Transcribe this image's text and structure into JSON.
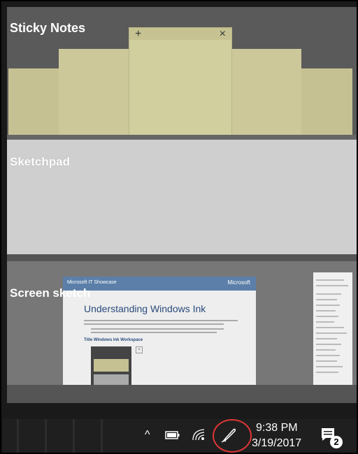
{
  "sticky_notes": {
    "title": "Sticky Notes",
    "note_add_glyph": "+",
    "note_close_glyph": "×"
  },
  "sketchpad": {
    "title": "Sketchpad"
  },
  "screen_sketch": {
    "title": "Screen sketch",
    "doc_header_left": "Microsoft IT Showcase",
    "doc_header_right": "Microsoft",
    "doc_title": "Understanding Windows Ink",
    "doc_subtitle": "Title Windows Ink Workspace"
  },
  "taskbar": {
    "chevron_glyph": "^",
    "time": "9:38 PM",
    "date": "3/19/2017",
    "notification_count": "2",
    "colors": {
      "highlight_circle": "#e03535",
      "taskbar_bg": "#1f1f1f"
    },
    "icons": [
      "show-hidden-icons-chevron-icon",
      "battery-icon",
      "wifi-icon",
      "windows-ink-pen-icon",
      "action-center-notification-icon"
    ]
  }
}
